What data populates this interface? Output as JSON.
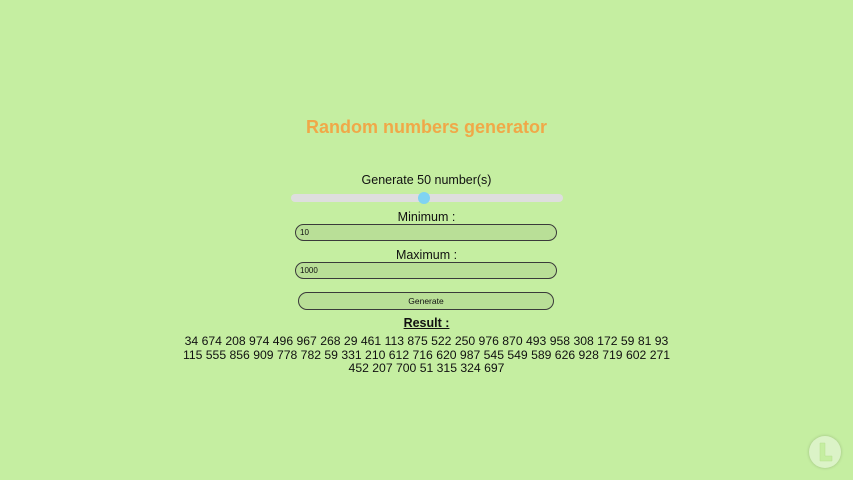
{
  "header": {
    "title": "Random numbers generator"
  },
  "controls": {
    "count_label": "Generate 50 number(s)",
    "count_value": 50,
    "count_fraction": 0.49,
    "minimum_label": "Minimum :",
    "minimum_value": "10",
    "maximum_label": "Maximum :",
    "maximum_value": "1000",
    "generate_label": "Generate"
  },
  "result": {
    "title": "Result :",
    "numbers": "34 674 208 974 496 967 268 29 461 113 875 522 250 976 870 493 958 308 172 59 81 93 115 555 856 909 778 782 59 331 210 612 716 620 987 545 549 589 626 928 719 602 271 452 207 700 51 315 324 697"
  },
  "logo": {
    "icon": "letter-l-logo-icon",
    "color": "#c5eea1"
  },
  "colors": {
    "background": "#c5eea1",
    "title": "#f0a848",
    "slider_thumb": "#7fd3f2"
  }
}
